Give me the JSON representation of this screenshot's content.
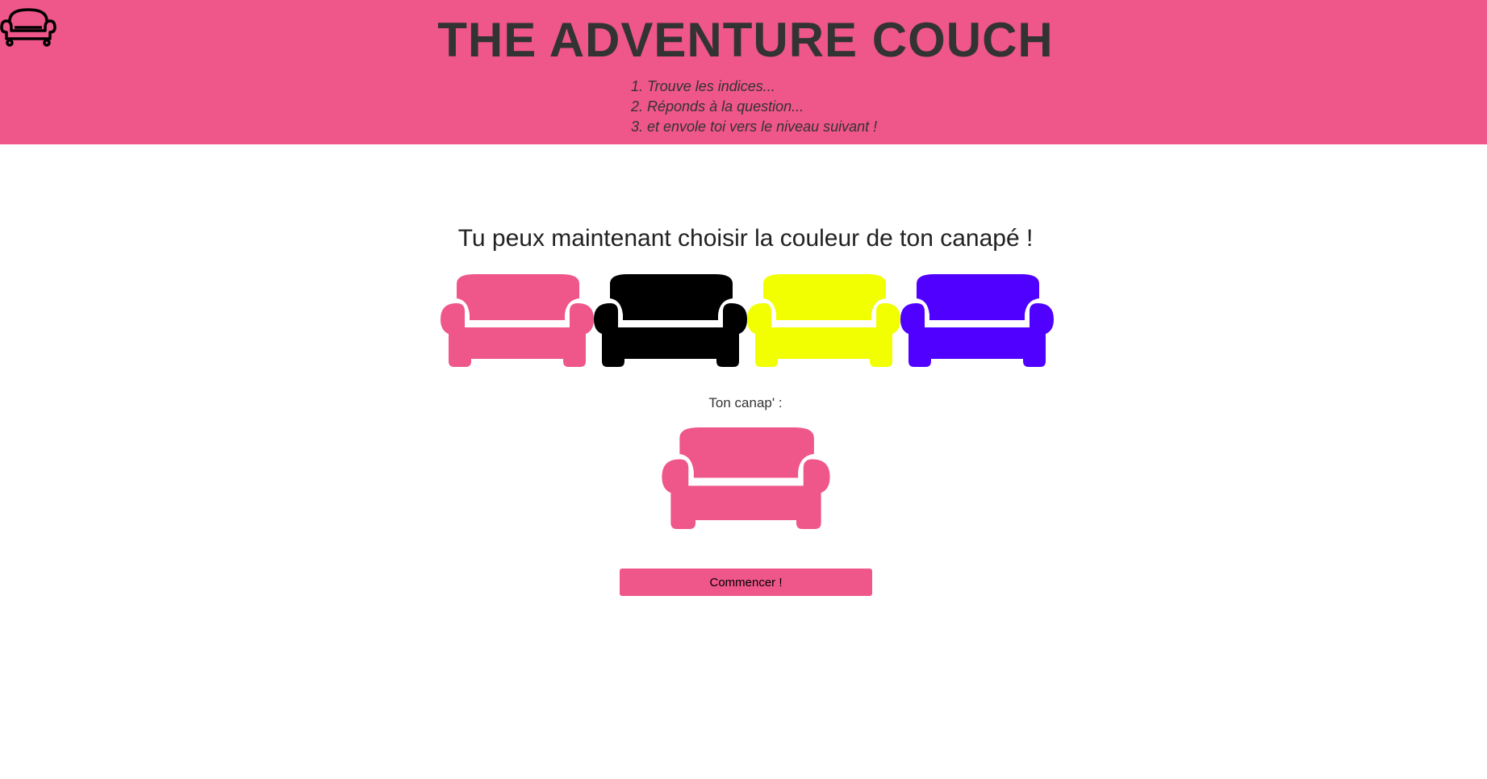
{
  "header": {
    "title": "THE ADVENTURE COUCH",
    "logo_icon": "couch-outline-icon",
    "steps": [
      "1. Trouve les indices...",
      "2. Réponds à la question...",
      "3. et envole toi vers le niveau suivant !"
    ]
  },
  "main": {
    "heading": "Tu peux maintenant choisir la couleur de ton canapé !",
    "couch_options": [
      {
        "name": "pink",
        "color": "#ef5689",
        "icon": "couch-icon"
      },
      {
        "name": "black",
        "color": "#000000",
        "icon": "couch-icon"
      },
      {
        "name": "yellow",
        "color": "#f2ff00",
        "icon": "couch-icon"
      },
      {
        "name": "purple",
        "color": "#5000ff",
        "icon": "couch-icon"
      }
    ],
    "selected_label": "Ton canap' :",
    "selected_color": "#ef5689",
    "start_button": "Commencer !"
  },
  "colors": {
    "accent": "#ef5689",
    "text": "#333333",
    "background": "#ffffff"
  }
}
